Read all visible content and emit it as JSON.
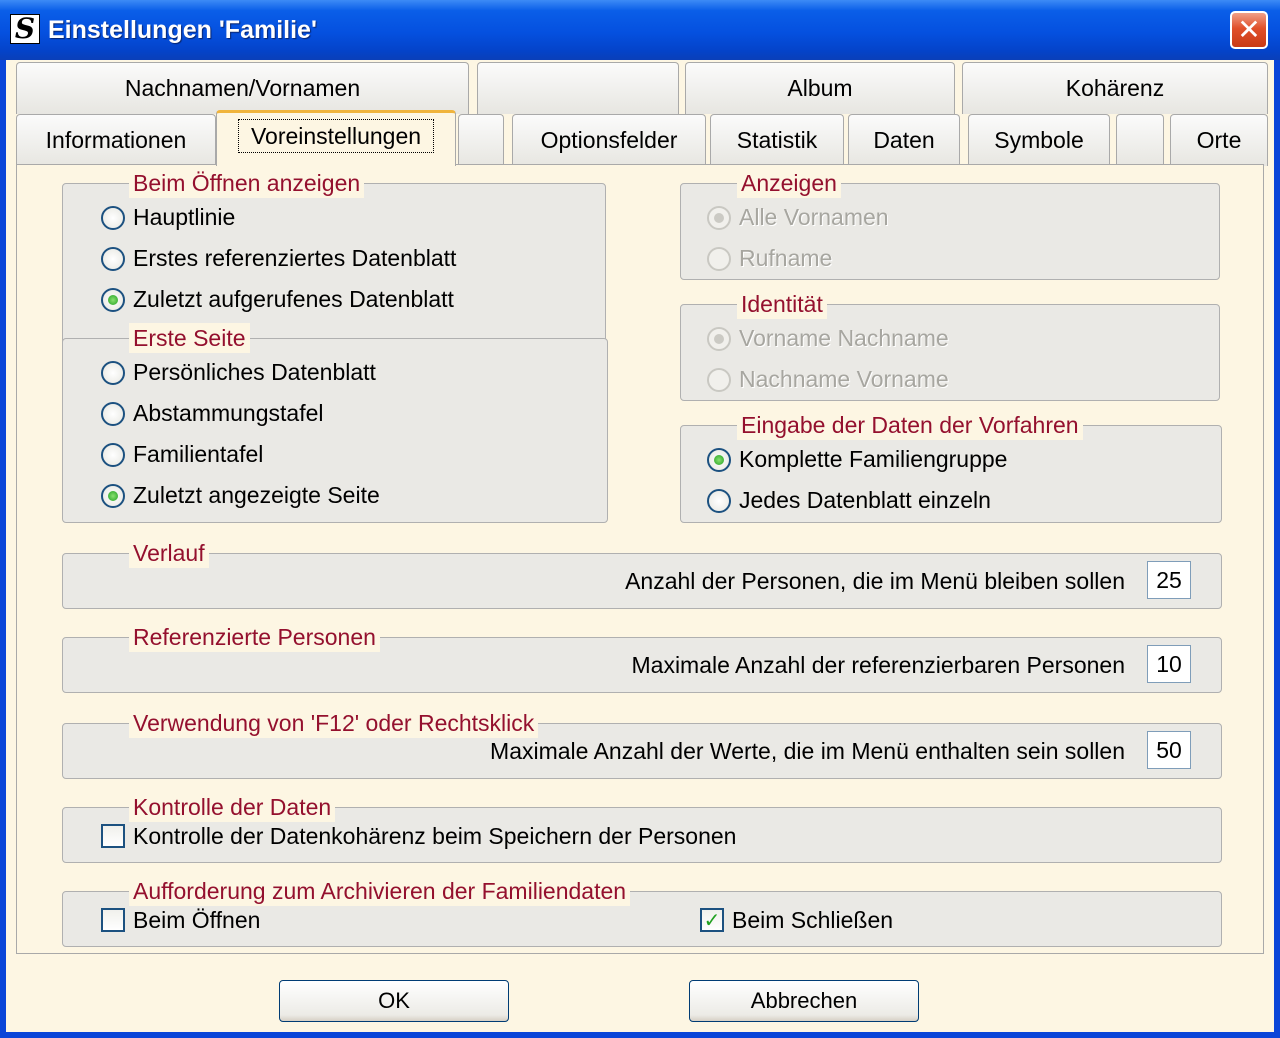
{
  "window": {
    "title": "Einstellungen 'Familie'",
    "app_icon_letter": "S",
    "close_glyph": "✕"
  },
  "tabs_row1": [
    "Nachnamen/Vornamen",
    "",
    "Album",
    "Kohärenz"
  ],
  "tabs_row2": [
    "Informationen",
    "Voreinstellungen",
    "",
    "Optionsfelder",
    "Statistik",
    "Daten",
    "Symbole",
    "",
    "Orte"
  ],
  "active_tab": "Voreinstellungen",
  "groups": {
    "beim_oeffnen": {
      "title": "Beim Öffnen anzeigen",
      "options": [
        "Hauptlinie",
        "Erstes referenziertes Datenblatt",
        "Zuletzt aufgerufenes Datenblatt"
      ],
      "selected": 2
    },
    "erste_seite": {
      "title": "Erste Seite",
      "options": [
        "Persönliches Datenblatt",
        "Abstammungstafel",
        "Familientafel",
        "Zuletzt angezeigte Seite"
      ],
      "selected": 3
    },
    "anzeigen": {
      "title": "Anzeigen",
      "options": [
        "Alle Vornamen",
        "Rufname"
      ],
      "selected": 0,
      "disabled": true
    },
    "identitaet": {
      "title": "Identität",
      "options": [
        "Vorname Nachname",
        "Nachname Vorname"
      ],
      "selected": 0,
      "disabled": true
    },
    "eingabe": {
      "title": "Eingabe der Daten der Vorfahren",
      "options": [
        "Komplette Familiengruppe",
        "Jedes Datenblatt einzeln"
      ],
      "selected": 0
    },
    "verlauf": {
      "title": "Verlauf",
      "label": "Anzahl der Personen, die im Menü bleiben sollen",
      "value": "25"
    },
    "referenzierte": {
      "title": "Referenzierte Personen",
      "label": "Maximale Anzahl der referenzierbaren Personen",
      "value": "10"
    },
    "verwendung": {
      "title": "Verwendung von 'F12' oder Rechtsklick",
      "label": "Maximale Anzahl der Werte, die im Menü enthalten sein sollen",
      "value": "50"
    },
    "kontrolle": {
      "title": "Kontrolle der Daten",
      "checkbox": "Kontrolle der Datenkohärenz beim Speichern der Personen",
      "checked": false
    },
    "archivieren": {
      "title": "Aufforderung zum Archivieren der Familiendaten",
      "open_label": "Beim Öffnen",
      "open_checked": false,
      "close_label": "Beim Schließen",
      "close_checked": true
    }
  },
  "buttons": {
    "ok": "OK",
    "cancel": "Abbrechen"
  },
  "colors": {
    "title_bar": "#0550df",
    "panel_bg": "#fdf6e3",
    "group_title": "#94102e",
    "active_tab_accent": "#f0b43c"
  }
}
